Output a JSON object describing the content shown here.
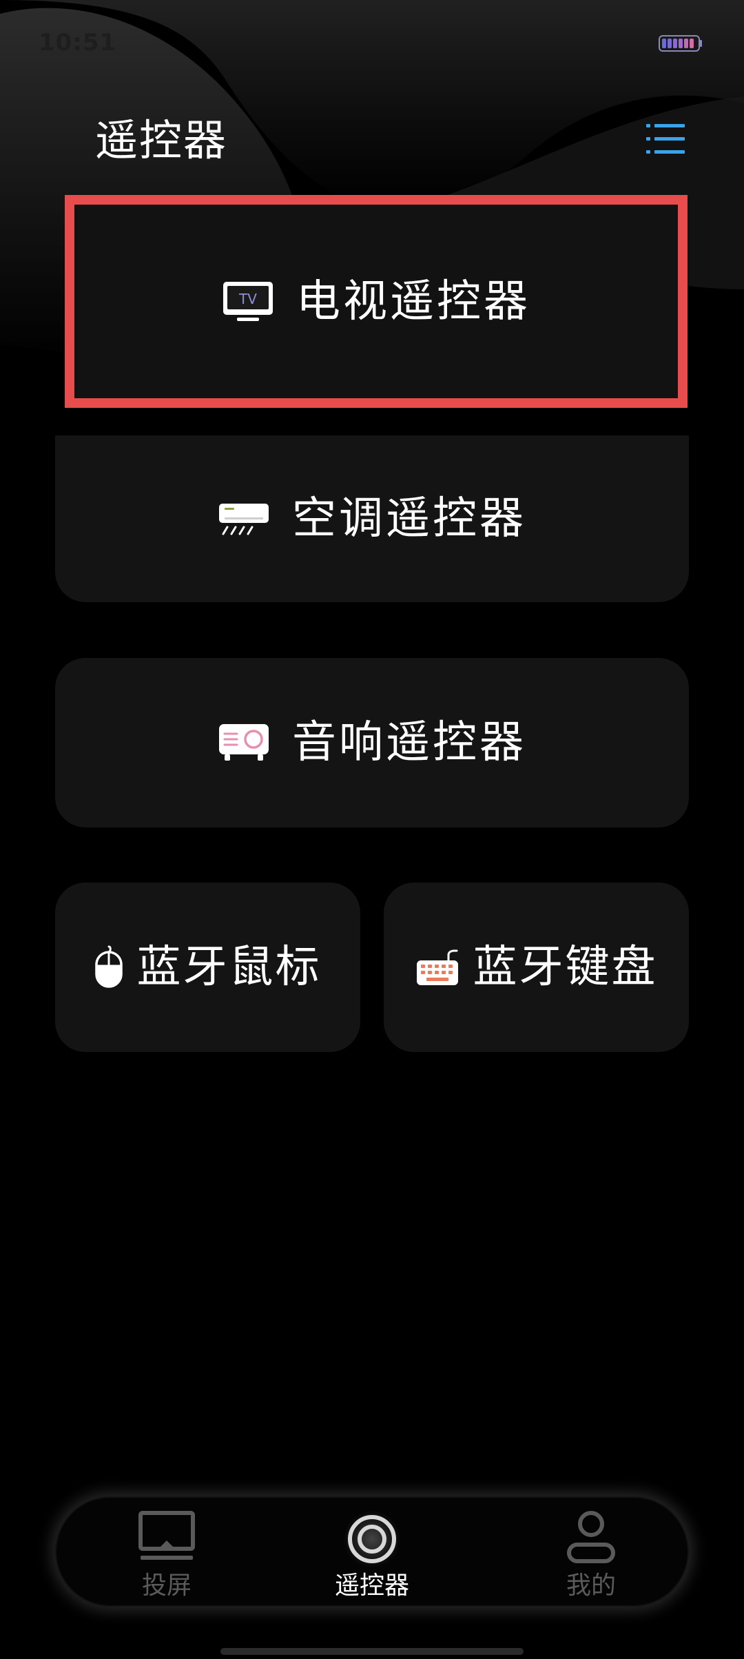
{
  "status_bar": {
    "time": "10:51"
  },
  "header": {
    "title": "遥控器",
    "menu_icon": "list-menu-icon"
  },
  "cards": {
    "tv": {
      "label": "电视遥控器",
      "icon": "tv-icon",
      "icon_text": "TV"
    },
    "ac": {
      "label": "空调遥控器",
      "icon": "air-conditioner-icon"
    },
    "audio": {
      "label": "音响遥控器",
      "icon": "speaker-icon"
    },
    "mouse": {
      "label": "蓝牙鼠标",
      "icon": "mouse-icon"
    },
    "keyboard": {
      "label": "蓝牙键盘",
      "icon": "keyboard-icon"
    }
  },
  "tab_bar": {
    "tabs": [
      {
        "label": "投屏",
        "icon": "screen-cast-icon",
        "active": false
      },
      {
        "label": "遥控器",
        "icon": "remote-target-icon",
        "active": true
      },
      {
        "label": "我的",
        "icon": "user-profile-icon",
        "active": false
      }
    ]
  },
  "colors": {
    "background": "#000000",
    "card": "#141414",
    "highlight_border": "#e84d4d",
    "menu_icon": "#3ba3e8",
    "inactive_tab": "#5a5a5a",
    "keyboard_icon": "#ef7a5a",
    "speaker_icon": "#e88fb0",
    "tv_icon_text": "#8f8fd8"
  }
}
